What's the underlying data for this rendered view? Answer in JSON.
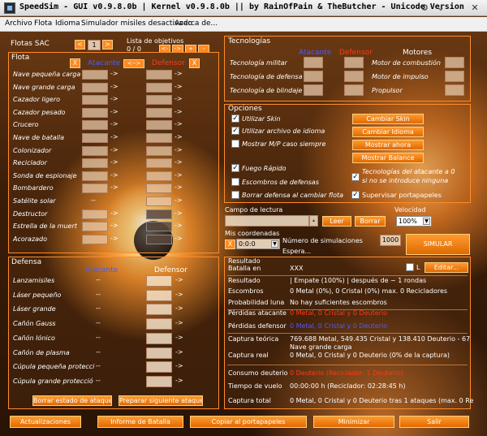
{
  "window": {
    "title": "SpeedSim - GUI v0.9.8.0b | Kernel v0.9.8.0b  ||  by RainOfPain & TheButcher - Unicode Version"
  },
  "menu": [
    "Archivo",
    "Flota",
    "Idioma",
    "Simulador misiles desactivado",
    "Acerca de..."
  ],
  "flotas": {
    "label": "Flotas SAC",
    "nav_prev": "<",
    "nav_value": "1",
    "nav_next": ">",
    "lista_label": "Lista de objetivos",
    "lista_count": "0 / 0",
    "lista_btns": [
      "<-",
      "->",
      "+",
      "-"
    ]
  },
  "flota": {
    "title": "Flota",
    "atacante": "Atacante",
    "defensor": "Defensor",
    "swap": "<-->",
    "clear": "X",
    "ships": [
      "Nave pequeña carga",
      "Nave grande carga",
      "Cazador ligero",
      "Cazador pesado",
      "Crucero",
      "Nave de batalla",
      "Colonizador",
      "Reciclador",
      "Sonda de espionaje",
      "Bombardero",
      "Satélite solar",
      "Destructor",
      "Estrella de la muert",
      "Acorazado"
    ],
    "arrow": "->",
    "dash": "--"
  },
  "defensa": {
    "title": "Defensa",
    "atacante": "Atacante",
    "defensor": "Defensor",
    "items": [
      "Lanzamisiles",
      "Láser pequeño",
      "Láser grande",
      "Cañón Gauss",
      "Cañón Iónico",
      "Cañón de plasma",
      "Cúpula pequeña protecci",
      "Cúpula grande protecció"
    ],
    "dash": "--",
    "arrow": "->",
    "btn_borrar": "Borrar estado de ataque",
    "btn_preparar": "Preparar siguiente ataque"
  },
  "tecnologias": {
    "title": "Tecnologías",
    "atacante": "Atacante",
    "defensor": "Defensor",
    "motores": "Motores",
    "left": [
      "Tecnología militar",
      "Tecnología de defensa",
      "Tecnología de blindaje"
    ],
    "right": [
      "Motor de combustión",
      "Motor de impulso",
      "Propulsor"
    ]
  },
  "opciones": {
    "title": "Opciones",
    "checks": [
      {
        "label": "Utilizar Skin",
        "checked": true
      },
      {
        "label": "Utilizar archivo de idioma",
        "checked": true
      },
      {
        "label": "Mostrar M/P caso siempre",
        "checked": false
      },
      {
        "label": "Fuego Rápido",
        "checked": true
      },
      {
        "label": "Escombros de defensas",
        "checked": false
      },
      {
        "label": "Borrar defensa al cambiar flota",
        "checked": false
      }
    ],
    "right_checks": [
      {
        "label": "Tecnologías del atacante a 0",
        "label2": "si no se introduce ninguna",
        "checked": true
      },
      {
        "label": "Supervisar portapapeles",
        "checked": true
      }
    ],
    "buttons": [
      "Cambiar Skin",
      "Cambiar Idioma",
      "Mostrar ahora",
      "Mostrar Balance"
    ]
  },
  "lectura": {
    "label": "Campo de lectura",
    "leer": "Leer",
    "borrar": "Borrar",
    "velocidad_label": "Velocidad",
    "velocidad_value": "100%"
  },
  "coordenadas": {
    "label": "Mis coordenadas",
    "value": "0:0:0",
    "x": "X",
    "num_label": "Número de simulaciones",
    "num_value": "1000",
    "status": "Espera...",
    "simular": "SIMULAR"
  },
  "resultado": {
    "title": "Resultado",
    "editar": "Editar...",
    "l_label": "L",
    "rows": [
      {
        "label": "Batalla en",
        "value": "XXX",
        "color": "white"
      },
      {
        "label": "Resultado",
        "value": "| Empate (100%) | después de ~ 1 rondas",
        "color": "white"
      },
      {
        "label": "Escombros",
        "value": "0 Metal (0%), 0 Cristal (0%) max. 0 Recicladores",
        "color": "white"
      },
      {
        "label": "Probabilidad luna",
        "value": "No hay suficientes escombros",
        "color": "white"
      },
      {
        "label": "Pérdidas atacante",
        "value": "0 Metal, 0 Cristal y 0 Deuterio",
        "color": "red"
      },
      {
        "label": "Pérdidas defensor",
        "value": "0 Metal, 0 Cristal y 0 Deuterio",
        "color": "blue"
      },
      {
        "label": "Captura teórica",
        "value": "769.688 Metal, 549.435 Cristal y 138.410 Deuterio - 67",
        "value2": "Nave grande carga",
        "color": "white"
      },
      {
        "label": "Captura real",
        "value": "0 Metal, 0 Cristal y 0 Deuterio (0% de la captura)",
        "color": "white"
      },
      {
        "label": "Consumo deuterio",
        "value": "0 Deuterio (Reciclador: 1 Deuterio)",
        "color": "red"
      },
      {
        "label": "Tiempo de vuelo",
        "value": "00:00:00 h (Reciclador: 02:28:45 h)",
        "color": "white"
      },
      {
        "label": "Captura total",
        "value": "0 Metal, 0 Cristal y 0 Deuterio tras 1 ataques (max. 0 Re",
        "color": "white"
      }
    ]
  },
  "bottom": [
    "Actualizaciones",
    "Informe de Batalla",
    "Copiar al portapapeles",
    "Minimizar",
    "Salir"
  ],
  "colors": {
    "accent": "#ff8c2a",
    "attacker": "#4a5cff",
    "defender": "#ff3a1a"
  }
}
